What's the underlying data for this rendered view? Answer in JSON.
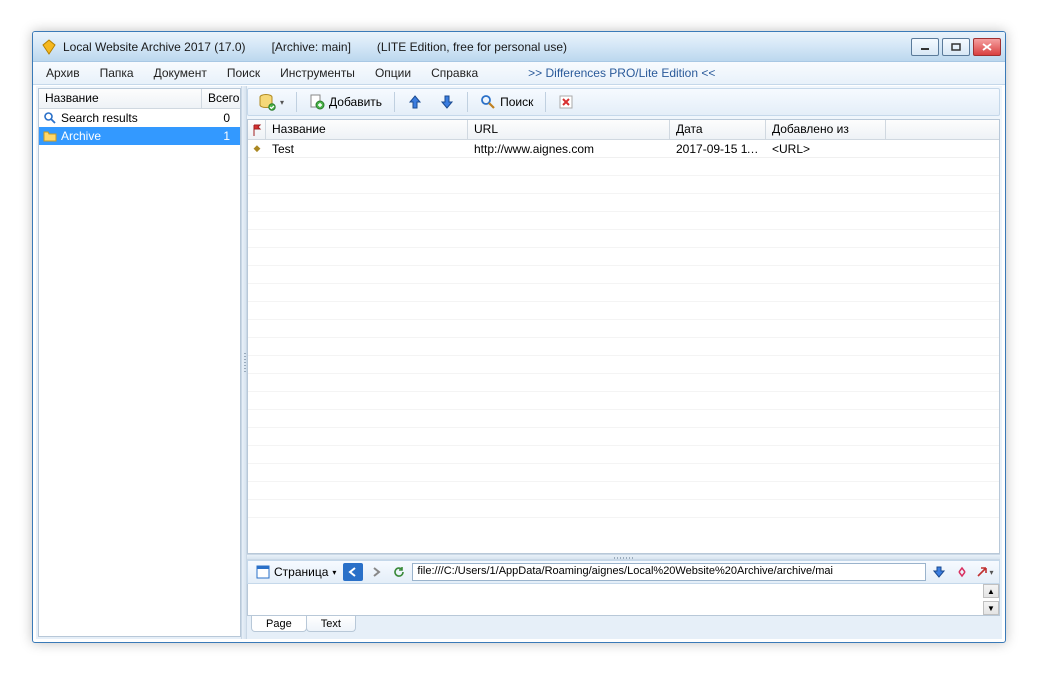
{
  "title": {
    "app": "Local Website Archive 2017 (17.0)",
    "archive": "[Archive: main]",
    "edition": "(LITE Edition, free for personal use)"
  },
  "menu": {
    "archive": "Архив",
    "folder": "Папка",
    "document": "Документ",
    "search": "Поиск",
    "tools": "Инструменты",
    "options": "Опции",
    "help": "Справка",
    "diff": ">> Differences PRO/Lite Edition <<"
  },
  "sidebar": {
    "col_name": "Название",
    "col_total": "Всего",
    "items": [
      {
        "label": "Search results",
        "count": "0"
      },
      {
        "label": "Archive",
        "count": "1"
      }
    ]
  },
  "toolbar": {
    "add": "Добавить",
    "search": "Поиск"
  },
  "list": {
    "col_name": "Название",
    "col_url": "URL",
    "col_date": "Дата",
    "col_added": "Добавлено из",
    "rows": [
      {
        "name": "Test",
        "url": "http://www.aignes.com",
        "date": "2017-09-15 11:...",
        "added": "<URL>"
      }
    ]
  },
  "browser": {
    "page_label": "Страница",
    "address": "file:///C:/Users/1/AppData/Roaming/aignes/Local%20Website%20Archive/archive/mai"
  },
  "bottom_tabs": {
    "page": "Page",
    "text": "Text"
  }
}
